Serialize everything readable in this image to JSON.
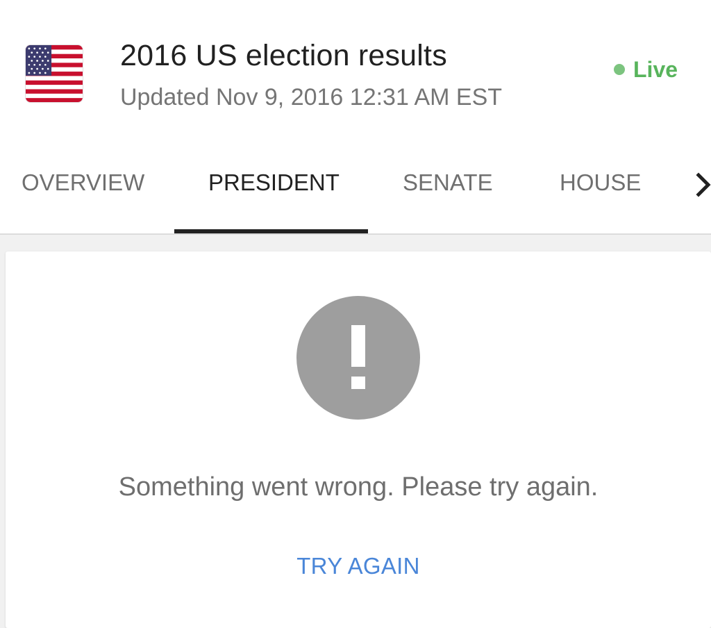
{
  "header": {
    "flag_icon": "us-flag-icon",
    "title": "2016 US election results",
    "updated": "Updated Nov 9, 2016 12:31 AM EST",
    "live_label": "Live",
    "live_color": "#58b45c"
  },
  "tabs": {
    "items": [
      {
        "label": "OVERVIEW",
        "active": false
      },
      {
        "label": "PRESIDENT",
        "active": true
      },
      {
        "label": "SENATE",
        "active": false
      },
      {
        "label": "HOUSE",
        "active": false
      }
    ],
    "more_icon": "chevron-right-icon"
  },
  "error": {
    "icon": "exclamation-circle-icon",
    "message": "Something went wrong. Please try again.",
    "retry_label": "TRY AGAIN",
    "retry_color": "#4a86d8"
  }
}
